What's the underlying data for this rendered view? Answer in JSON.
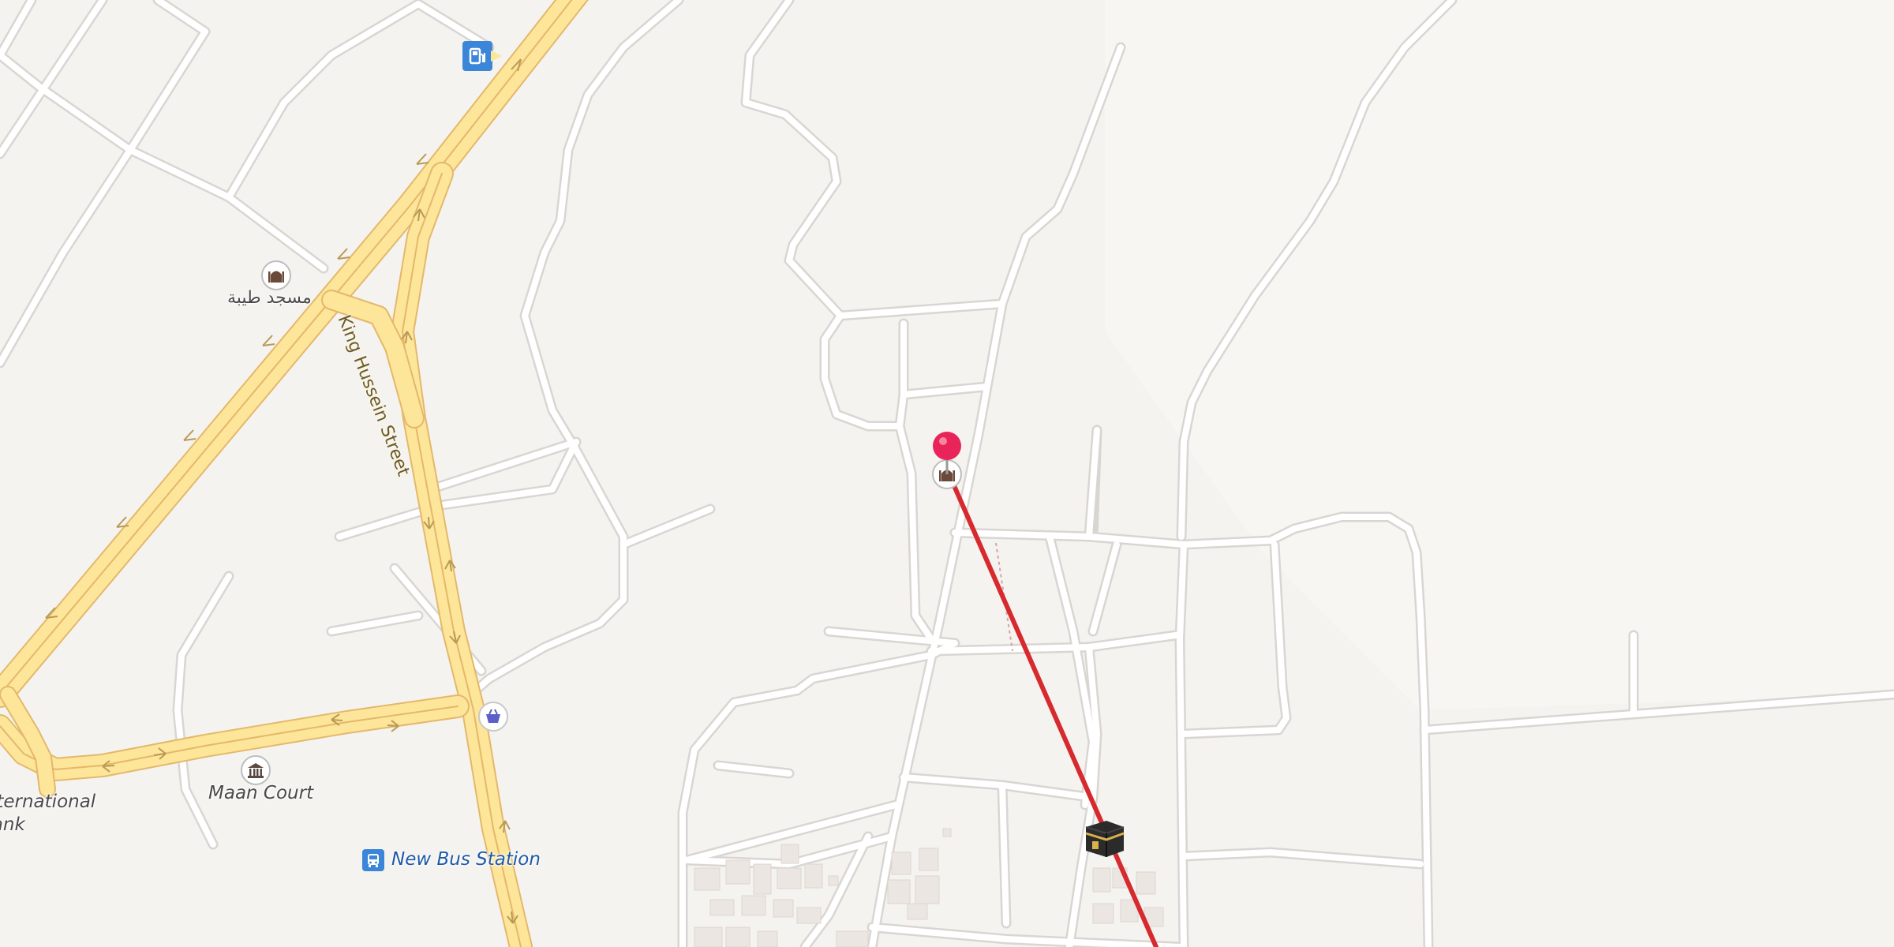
{
  "map": {
    "streets": [
      {
        "name": "King Hussein Street"
      }
    ],
    "places": [
      {
        "name": "مسجد طيبة",
        "category": "mosque",
        "icon": "mosque-icon"
      },
      {
        "name": "Maan Court",
        "category": "government",
        "icon": "courthouse-icon"
      },
      {
        "name": "New Bus Station",
        "category": "transit",
        "icon": "bus-icon"
      },
      {
        "name": "International\nBank",
        "category": "bank",
        "icon": "bank-icon"
      }
    ],
    "pois": [
      {
        "icon": "fuel-station-icon",
        "category": "gas station"
      },
      {
        "icon": "shopping-basket-icon",
        "category": "shop"
      },
      {
        "icon": "mosque-icon",
        "category": "mosque"
      },
      {
        "icon": "kaaba-icon",
        "category": "qibla"
      }
    ],
    "markers": [
      {
        "icon": "location-pin-icon",
        "color": "#e8245a"
      }
    ],
    "overlays": [
      {
        "type": "qibla-direction-line",
        "color": "#d62a2f"
      }
    ],
    "colors": {
      "background": "#f5f3f0",
      "minor_road": "#ffffff",
      "road_casing": "#d9d6d2",
      "highway": "#fde59a",
      "highway_casing": "#e4b86a",
      "building": "#ebe6e1"
    }
  }
}
